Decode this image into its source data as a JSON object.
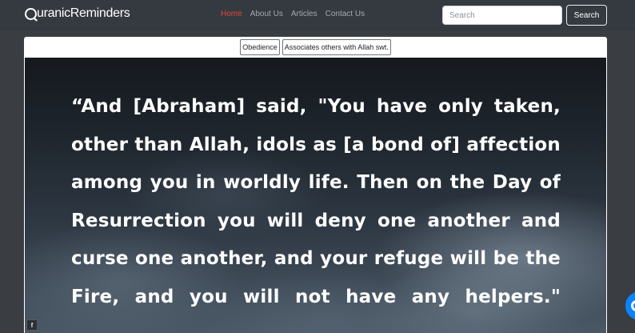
{
  "navbar": {
    "brand": "uranicReminders",
    "links": [
      {
        "label": "Home",
        "active": true
      },
      {
        "label": "About Us",
        "active": false
      },
      {
        "label": "Articles",
        "active": false
      },
      {
        "label": "Contact Us",
        "active": false
      }
    ],
    "search_placeholder": "Search",
    "search_button": "Search"
  },
  "tags": [
    "Obedience",
    "Associates others with Allah swt."
  ],
  "quote": "“And [Abraham] said, \"You have only taken, other than Allah, idols as [a bond of] affection among you in worldly life. Then on the Day of Resurrection you will deny one another and curse one another, and your refuge will be the Fire, and you will not have any helpers.\"",
  "share": {
    "facebook_glyph": "f"
  },
  "colors": {
    "navbar": "#343a40",
    "active_link": "#e0493c",
    "page_bg": "#3a3d42",
    "chat_widget": "#0a84ff"
  }
}
